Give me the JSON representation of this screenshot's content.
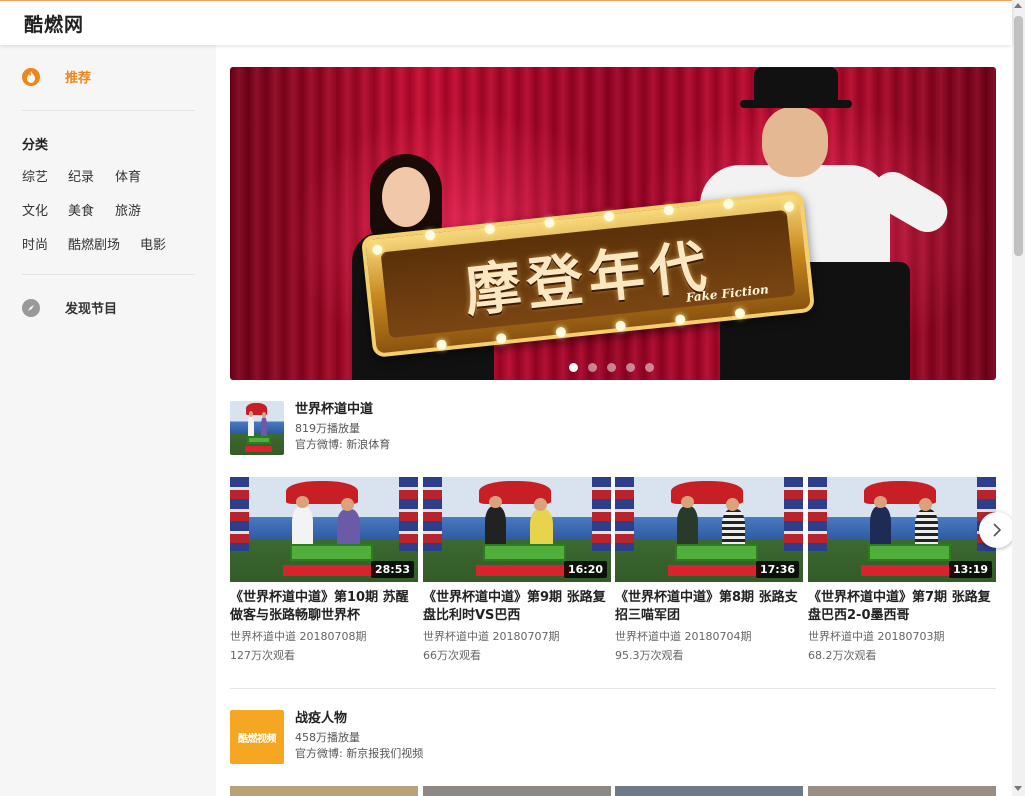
{
  "header": {
    "logo": "酷燃网"
  },
  "sidebar": {
    "recommend_label": "推荐",
    "category_title": "分类",
    "categories": [
      "综艺",
      "纪录",
      "体育",
      "文化",
      "美食",
      "旅游",
      "时尚",
      "酷燃剧场",
      "电影"
    ],
    "discover_label": "发现节目"
  },
  "banner": {
    "title": "摩登年代",
    "subtitle": "Fake Fiction",
    "slides": 5,
    "active_slide": 1
  },
  "channels": [
    {
      "name": "世界杯道中道",
      "plays": "819万播放量",
      "source": "官方微博: 新浪体育",
      "videos": [
        {
          "title": "《世界杯道中道》第10期 苏醒做客与张路畅聊世界杯",
          "sub": "世界杯道中道 20180708期",
          "views": "127万次观看",
          "duration": "28:53"
        },
        {
          "title": "《世界杯道中道》第9期 张路复盘比利时VS巴西",
          "sub": "世界杯道中道 20180707期",
          "views": "66万次观看",
          "duration": "16:20"
        },
        {
          "title": "《世界杯道中道》第8期 张路支招三喵军团",
          "sub": "世界杯道中道 20180704期",
          "views": "95.3万次观看",
          "duration": "17:36"
        },
        {
          "title": "《世界杯道中道》第7期 张路复盘巴西2-0墨西哥",
          "sub": "世界杯道中道 20180703期",
          "views": "68.2万次观看",
          "duration": "13:19"
        }
      ]
    },
    {
      "name": "战疫人物",
      "plays": "458万播放量",
      "source": "官方微博: 新京报我们视频",
      "thumb_text": "酷燃视频"
    }
  ],
  "icons": {
    "recommend": "flame-icon",
    "discover": "compass-icon",
    "next": "chevron-right-icon"
  },
  "colors": {
    "accent": "#f08519"
  }
}
